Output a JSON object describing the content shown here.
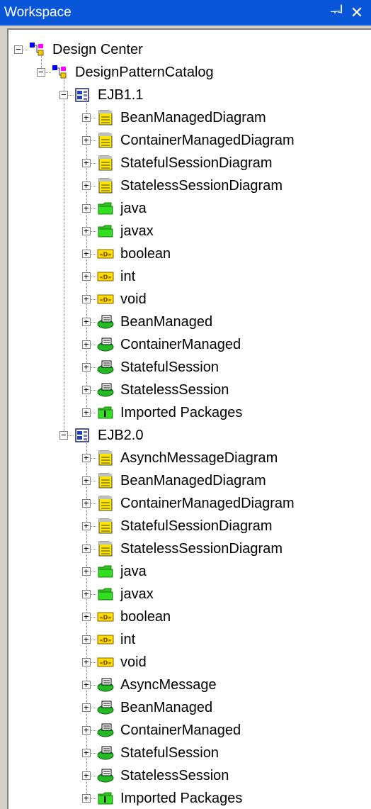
{
  "workspace": {
    "title": "Workspace",
    "pin_glyph": "ᅯ",
    "close_glyph": "✕"
  },
  "tree": {
    "label": "Design Center",
    "icon": "design-center-icon",
    "expanded": true,
    "children": [
      {
        "label": "DesignPatternCatalog",
        "icon": "design-center-icon",
        "expanded": true,
        "children": [
          {
            "label": "EJB1.1",
            "icon": "package-diagram-icon",
            "expanded": true,
            "children": [
              {
                "label": "BeanManagedDiagram",
                "icon": "diagram-icon"
              },
              {
                "label": "ContainerManagedDiagram",
                "icon": "diagram-icon"
              },
              {
                "label": "StatefulSessionDiagram",
                "icon": "diagram-icon"
              },
              {
                "label": "StatelessSessionDiagram",
                "icon": "diagram-icon"
              },
              {
                "label": "java",
                "icon": "folder-icon"
              },
              {
                "label": "javax",
                "icon": "folder-icon"
              },
              {
                "label": "boolean",
                "icon": "datatype-icon"
              },
              {
                "label": "int",
                "icon": "datatype-icon"
              },
              {
                "label": "void",
                "icon": "datatype-icon"
              },
              {
                "label": "BeanManaged",
                "icon": "component-icon"
              },
              {
                "label": "ContainerManaged",
                "icon": "component-icon"
              },
              {
                "label": "StatefulSession",
                "icon": "component-icon"
              },
              {
                "label": "StatelessSession",
                "icon": "component-icon"
              },
              {
                "label": "Imported Packages",
                "icon": "imported-packages-icon"
              }
            ]
          },
          {
            "label": "EJB2.0",
            "icon": "package-diagram-icon",
            "expanded": true,
            "children": [
              {
                "label": "AsynchMessageDiagram",
                "icon": "diagram-icon"
              },
              {
                "label": "BeanManagedDiagram",
                "icon": "diagram-icon"
              },
              {
                "label": "ContainerManagedDiagram",
                "icon": "diagram-icon"
              },
              {
                "label": "StatefulSessionDiagram",
                "icon": "diagram-icon"
              },
              {
                "label": "StatelessSessionDiagram",
                "icon": "diagram-icon"
              },
              {
                "label": "java",
                "icon": "folder-icon"
              },
              {
                "label": "javax",
                "icon": "folder-icon"
              },
              {
                "label": "boolean",
                "icon": "datatype-icon"
              },
              {
                "label": "int",
                "icon": "datatype-icon"
              },
              {
                "label": "void",
                "icon": "datatype-icon"
              },
              {
                "label": "AsyncMessage",
                "icon": "component-icon"
              },
              {
                "label": "BeanManaged",
                "icon": "component-icon"
              },
              {
                "label": "ContainerManaged",
                "icon": "component-icon"
              },
              {
                "label": "StatefulSession",
                "icon": "component-icon"
              },
              {
                "label": "StatelessSession",
                "icon": "component-icon"
              },
              {
                "label": "Imported Packages",
                "icon": "imported-packages-icon"
              }
            ]
          }
        ]
      }
    ]
  }
}
